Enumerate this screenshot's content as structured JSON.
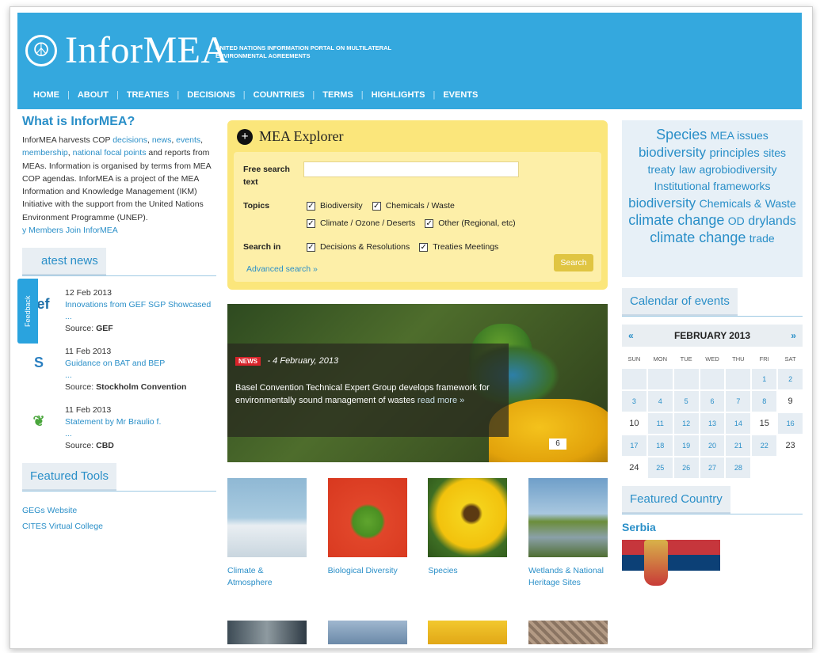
{
  "header": {
    "site_name": "InforMEA",
    "tagline": "UNITED NATIONS INFORMATION PORTAL ON MULTILATERAL ENVIRONMENTAL AGREEMENTS",
    "nav": [
      "HOME",
      "ABOUT",
      "TREATIES",
      "DECISIONS",
      "COUNTRIES",
      "TERMS",
      "HIGHLIGHTS",
      "EVENTS"
    ]
  },
  "left": {
    "what_title": "What is InforMEA?",
    "what_p1": "InforMEA harvests COP ",
    "what_links": [
      "decisions",
      "news",
      "events",
      "membership",
      "national focal points"
    ],
    "what_p2": "and reports from MEAs. Information is organised by terms from MEA COP agendas. InforMEA is a project of the MEA Information and Knowledge Management (IKM) Initiative with the support from the United Nations Environment Programme (UNEP).",
    "members_link": "y Members",
    "join_link": "Join InforMEA",
    "feedback": "Feedback",
    "latest_news": "atest news",
    "news": [
      {
        "logo": "gef",
        "date": "12 Feb 2013",
        "title": "Innovations from GEF SGP Showcased ...",
        "source_label": "Source:",
        "source": "GEF"
      },
      {
        "logo": "S",
        "date": "11 Feb 2013",
        "title": "Guidance on BAT and BEP",
        "dots": "...",
        "source_label": "Source:",
        "source": "Stockholm Convention"
      },
      {
        "logo": "❦",
        "date": "11 Feb 2013",
        "title": "Statement by Mr Braulio f.",
        "dots": "...",
        "source_label": "Source:",
        "source": "CBD"
      }
    ],
    "featured_tools": "Featured Tools",
    "tools": [
      "GEGs Website",
      "CITES Virtual College"
    ]
  },
  "explorer": {
    "title": "MEA Explorer",
    "free_search_label": "Free search text",
    "topics_label": "Topics",
    "topics": [
      "Biodiversity",
      "Chemicals / Waste",
      "Climate / Ozone / Deserts",
      "Other (Regional, etc)"
    ],
    "search_in_label": "Search in",
    "search_in": [
      "Decisions & Resolutions",
      "Treaties Meetings"
    ],
    "advanced": "Advanced search »",
    "search_button": "Search"
  },
  "slider": {
    "badge": "NEWS",
    "date": "- 4 February, 2013",
    "text": "Basel Convention Technical Expert Group develops framework for environmentally sound management of wastes",
    "read_more": "read more »",
    "counter": "6"
  },
  "thumbs": [
    {
      "label": "Climate & Atmosphere"
    },
    {
      "label": "Biological Diversity"
    },
    {
      "label": "Species"
    },
    {
      "label": "Wetlands & National Heritage Sites"
    }
  ],
  "tagcloud": [
    {
      "t": "Species",
      "s": 18
    },
    {
      "t": "MEA issues",
      "s": 14
    },
    {
      "t": "biodiversity",
      "s": 17
    },
    {
      "t": "principles",
      "s": 15
    },
    {
      "t": "sites",
      "s": 14
    },
    {
      "t": "treaty",
      "s": 14
    },
    {
      "t": "law",
      "s": 14
    },
    {
      "t": "agrobiodiversity",
      "s": 14
    },
    {
      "t": "Institutional frameworks",
      "s": 14
    },
    {
      "t": "biodiversity",
      "s": 17
    },
    {
      "t": "Chemicals &",
      "s": 14
    },
    {
      "t": "Waste",
      "s": 14
    },
    {
      "t": "climate change",
      "s": 18
    },
    {
      "t": "OD",
      "s": 14
    },
    {
      "t": "drylands",
      "s": 16
    },
    {
      "t": "climate change",
      "s": 18
    },
    {
      "t": "trade",
      "s": 14
    }
  ],
  "calendar": {
    "tab": "Calendar of events",
    "prev": "«",
    "next": "»",
    "month": "FEBRUARY 2013",
    "dow": [
      "SUN",
      "MON",
      "TUE",
      "WED",
      "THU",
      "FRI",
      "SAT"
    ],
    "days": [
      "",
      "",
      "",
      "",
      "",
      "1",
      "2",
      "3",
      "4",
      "5",
      "6",
      "7",
      "8",
      "9",
      "10",
      "11",
      "12",
      "13",
      "14",
      "15",
      "16",
      "17",
      "18",
      "19",
      "20",
      "21",
      "22",
      "23",
      "24",
      "25",
      "26",
      "27",
      "28"
    ],
    "plain": [
      "9",
      "10",
      "15",
      "23",
      "24"
    ]
  },
  "featured": {
    "tab": "Featured Country",
    "country": "Serbia"
  },
  "colors": {
    "header": "#34a8de",
    "explorer": "#fbe67b",
    "link": "#2a8fc8"
  }
}
